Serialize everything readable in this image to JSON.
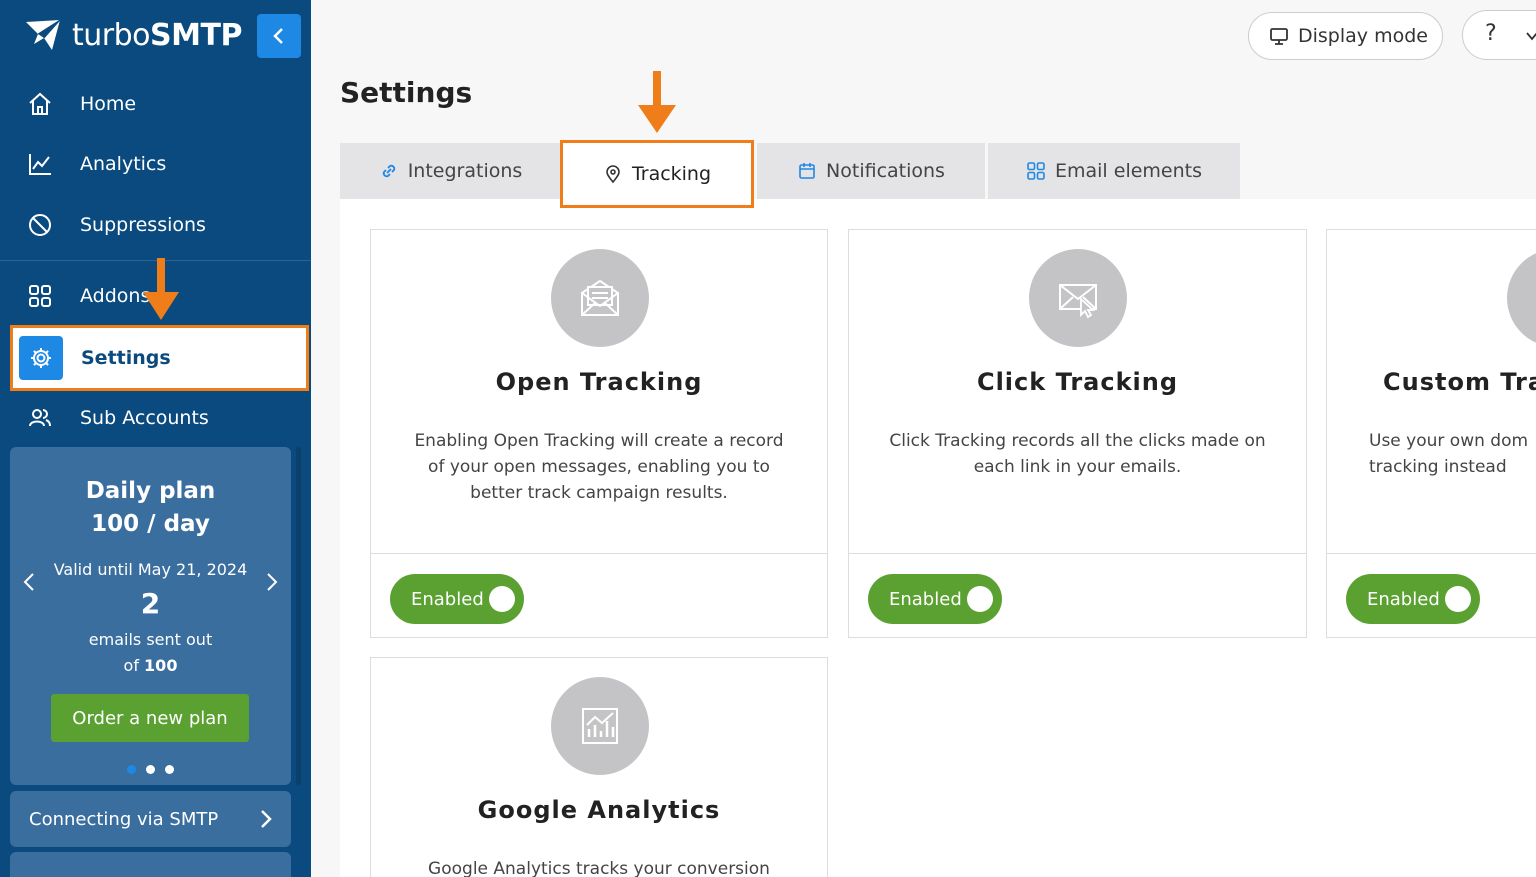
{
  "brand": {
    "name_light": "turbo",
    "name_bold": "SMTP"
  },
  "sidebar": {
    "items": [
      {
        "label": "Home",
        "icon": "home-icon"
      },
      {
        "label": "Analytics",
        "icon": "analytics-icon"
      },
      {
        "label": "Suppressions",
        "icon": "suppressions-icon"
      },
      {
        "label": "Addons",
        "icon": "addons-icon"
      },
      {
        "label": "Settings",
        "icon": "gear-icon"
      },
      {
        "label": "Sub Accounts",
        "icon": "users-icon"
      }
    ],
    "plan": {
      "title_line1": "Daily plan",
      "title_line2": "100 / day",
      "valid": "Valid until May 21, 2024",
      "count": "2",
      "sent_line1": "emails sent out",
      "sent_prefix": "of ",
      "sent_total": "100",
      "button": "Order a new plan"
    },
    "smtp_label": "Connecting via SMTP"
  },
  "topbar": {
    "display_mode": "Display mode",
    "help": "?"
  },
  "page": {
    "title": "Settings"
  },
  "tabs": [
    {
      "label": "Integrations",
      "icon": "link-icon"
    },
    {
      "label": "Tracking",
      "icon": "location-pin-icon"
    },
    {
      "label": "Notifications",
      "icon": "calendar-icon"
    },
    {
      "label": "Email elements",
      "icon": "grid-icon"
    }
  ],
  "cards": [
    {
      "title": "Open Tracking",
      "description": "Enabling Open Tracking will create a record\nof your open messages, enabling you to\nbetter track campaign results.",
      "toggle": "Enabled"
    },
    {
      "title": "Click Tracking",
      "description": "Click Tracking records all the clicks made on\neach link in your emails.",
      "toggle": "Enabled"
    },
    {
      "title": "Custom Tra",
      "description": "Use your own dom\ntracking instead",
      "toggle": "Enabled"
    },
    {
      "title": "Google Analytics",
      "description": "Google Analytics tracks your conversion",
      "toggle": ""
    }
  ],
  "colors": {
    "sidebar": "#0a4a7e",
    "accent_blue": "#1e88e5",
    "highlight_orange": "#ef7d1a",
    "toggle_green": "#5aa131"
  }
}
